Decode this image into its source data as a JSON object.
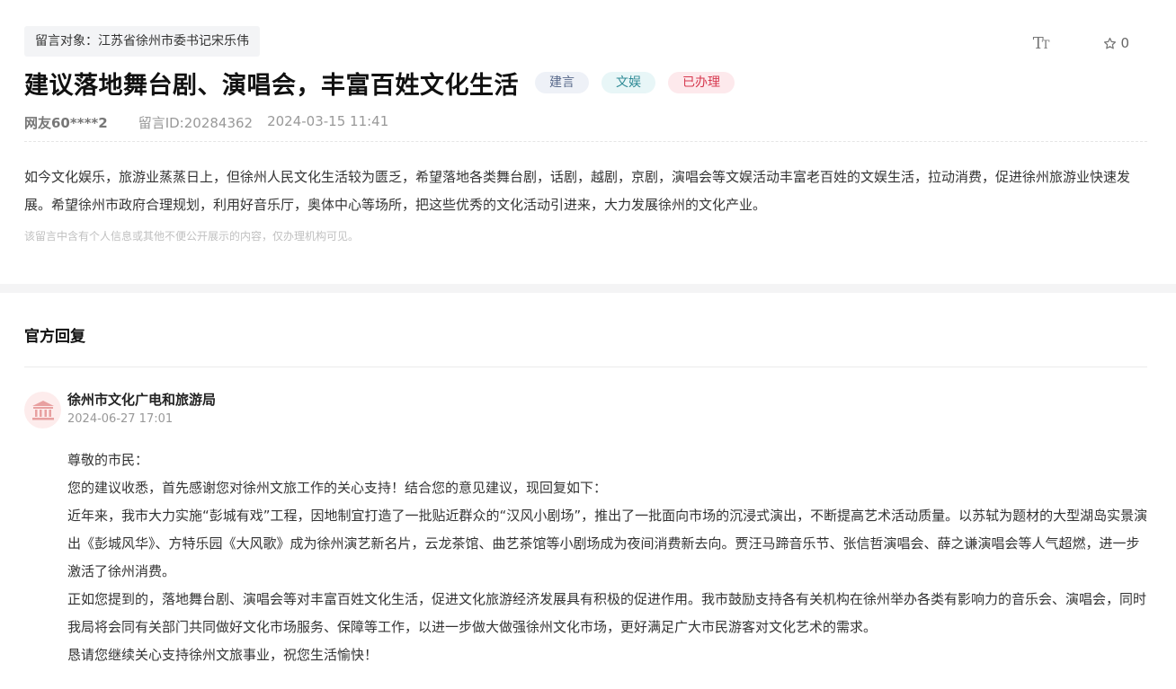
{
  "message": {
    "recipient": "留言对象：江苏省徐州市委书记宋乐伟",
    "font_toggle_label": "T",
    "font_toggle_small": "T",
    "like_count": "0",
    "title": "建议落地舞台剧、演唱会，丰富百姓文化生活",
    "tags": [
      "建言",
      "文娱",
      "已办理"
    ],
    "author": "网友60****2",
    "message_id": "留言ID:20284362",
    "datetime": "2024-03-15 11:41",
    "content": "如今文化娱乐，旅游业蒸蒸日上，但徐州人民文化生活较为匮乏，希望落地各类舞台剧，话剧，越剧，京剧，演唱会等文娱活动丰富老百姓的文娱生活，拉动消费，促进徐州旅游业快速发展。希望徐州市政府合理规划，利用好音乐厅，奥体中心等场所，把这些优秀的文化活动引进来，大力发展徐州的文化产业。",
    "privacy_note": "该留言中含有个人信息或其他不便公开展示的内容，仅办理机构可见。"
  },
  "reply": {
    "heading": "官方回复",
    "org": "徐州市文化广电和旅游局",
    "datetime": "2024-06-27 17:01",
    "paragraphs": [
      "尊敬的市民：",
      "您的建议收悉，首先感谢您对徐州文旅工作的关心支持！结合您的意见建议，现回复如下：",
      "近年来，我市大力实施“彭城有戏”工程，因地制宜打造了一批贴近群众的“汉风小剧场”，推出了一批面向市场的沉浸式演出，不断提高艺术活动质量。以苏轼为题材的大型湖岛实景演出《彭城风华》、方特乐园《大风歌》成为徐州演艺新名片，云龙茶馆、曲艺茶馆等小剧场成为夜间消费新去向。贾汪马蹄音乐节、张信哲演唱会、薛之谦演唱会等人气超燃，进一步激活了徐州消费。",
      "正如您提到的，落地舞台剧、演唱会等对丰富百姓文化生活，促进文化旅游经济发展具有积极的促进作用。我市鼓励支持各有关机构在徐州举办各类有影响力的音乐会、演唱会，同时我局将会同有关部门共同做好文化市场服务、保障等工作，以进一步做大做强徐州文化市场，更好满足广大市民游客对文化艺术的需求。",
      "恳请您继续关心支持徐州文旅事业，祝您生活愉快！"
    ]
  },
  "icons": {
    "font": "font-size-icon",
    "like": "star-icon",
    "avatar": "government-building-icon"
  },
  "colors": {
    "tag_suggestion": "#5a6b8c",
    "tag_entertainment": "#2f8b96",
    "tag_done": "#d6394f",
    "avatar_icon": "#e8a0a0"
  }
}
